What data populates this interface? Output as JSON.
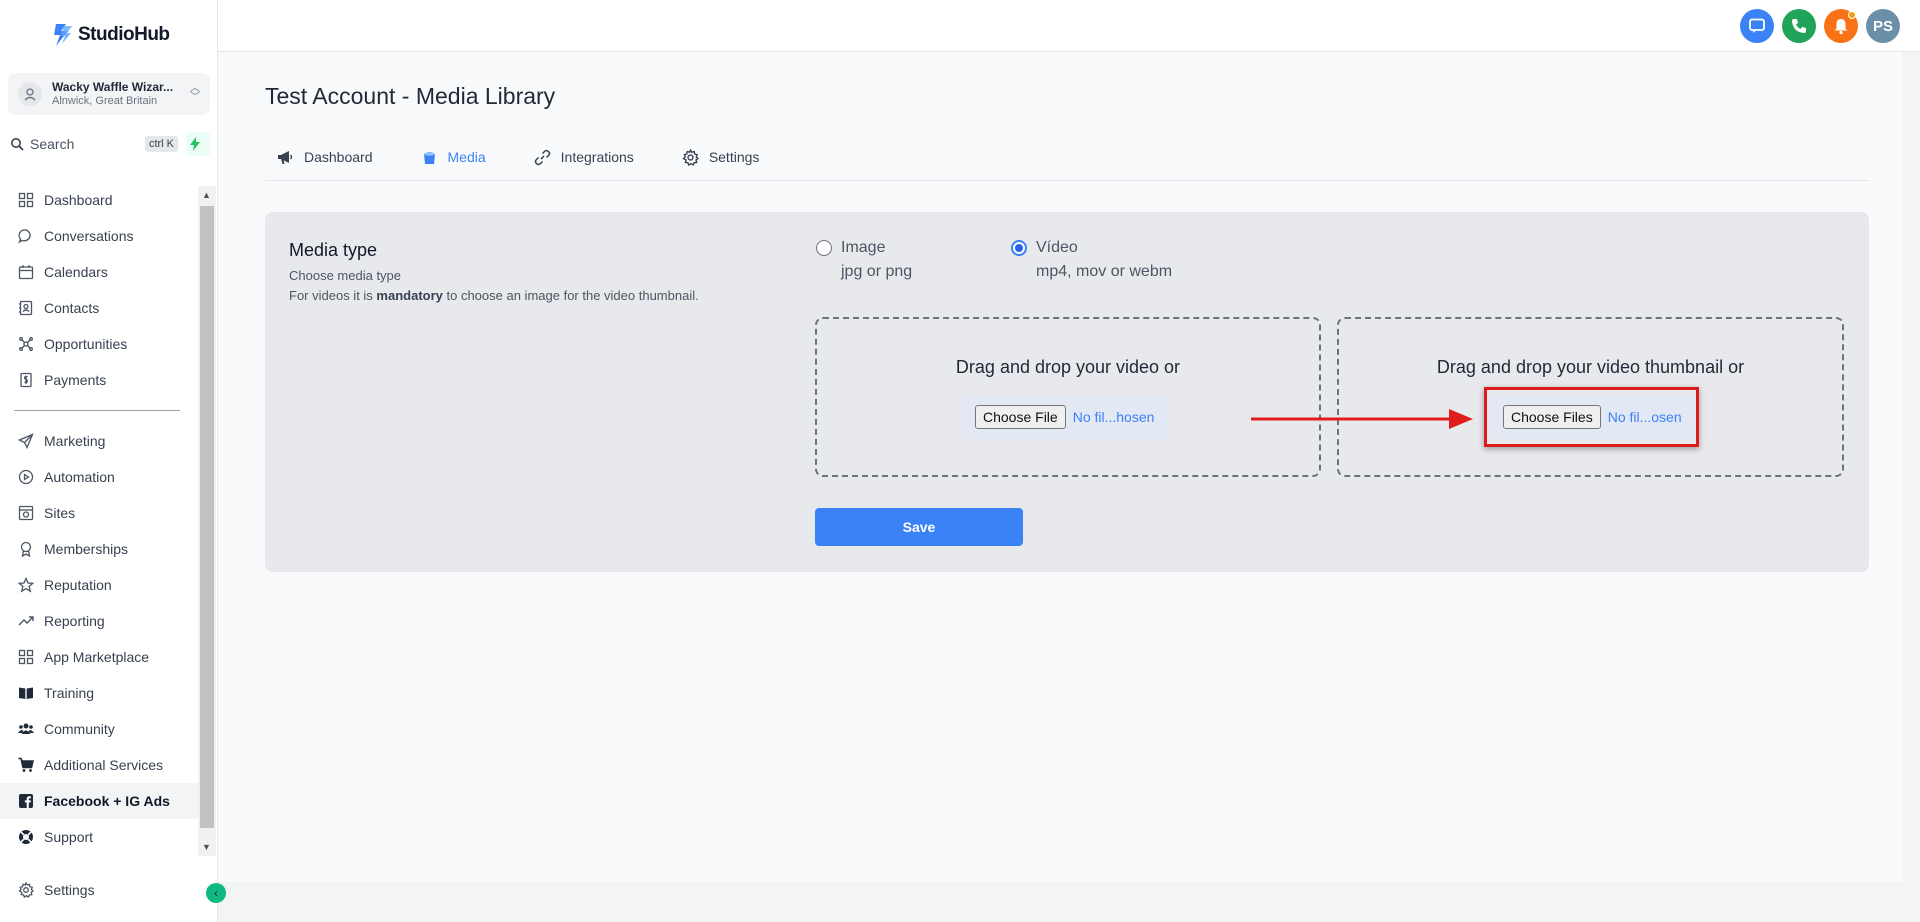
{
  "app": {
    "name": "StudioHub"
  },
  "account": {
    "name": "Wacky Waffle Wizar...",
    "location": "Alnwick, Great Britain"
  },
  "search": {
    "label": "Search",
    "shortcut": "ctrl K"
  },
  "sidebar": {
    "items": [
      {
        "label": "Dashboard",
        "icon": "grid-icon"
      },
      {
        "label": "Conversations",
        "icon": "chat-bubble-icon"
      },
      {
        "label": "Calendars",
        "icon": "calendar-icon"
      },
      {
        "label": "Contacts",
        "icon": "contacts-icon"
      },
      {
        "label": "Opportunities",
        "icon": "opportunities-icon"
      },
      {
        "label": "Payments",
        "icon": "payments-icon"
      }
    ],
    "items2": [
      {
        "label": "Marketing",
        "icon": "paper-plane-icon"
      },
      {
        "label": "Automation",
        "icon": "automation-icon"
      },
      {
        "label": "Sites",
        "icon": "sites-icon"
      },
      {
        "label": "Memberships",
        "icon": "membership-icon"
      },
      {
        "label": "Reputation",
        "icon": "star-icon"
      },
      {
        "label": "Reporting",
        "icon": "trend-icon"
      },
      {
        "label": "App Marketplace",
        "icon": "apps-icon"
      },
      {
        "label": "Training",
        "icon": "book-icon"
      },
      {
        "label": "Community",
        "icon": "users-icon"
      },
      {
        "label": "Additional Services",
        "icon": "cart-icon"
      },
      {
        "label": "Facebook + IG Ads",
        "icon": "facebook-icon"
      },
      {
        "label": "Support",
        "icon": "lifebuoy-icon"
      }
    ],
    "settings_label": "Settings"
  },
  "topbar": {
    "avatar_initials": "PS"
  },
  "page": {
    "title": "Test Account - Media Library"
  },
  "tabs": [
    {
      "label": "Dashboard",
      "active": false
    },
    {
      "label": "Media",
      "active": true
    },
    {
      "label": "Integrations",
      "active": false
    },
    {
      "label": "Settings",
      "active": false
    }
  ],
  "media_type": {
    "title": "Media type",
    "desc_line1": "Choose media type",
    "desc_pre": "For videos it is ",
    "desc_bold": "mandatory",
    "desc_post": " to choose an image for the video thumbnail.",
    "options": [
      {
        "label": "Image",
        "sub": "jpg or png",
        "checked": false
      },
      {
        "label": "Vídeo",
        "sub": "mp4, mov or webm",
        "checked": true
      }
    ]
  },
  "upload": {
    "video": {
      "prompt": "Drag and drop your video or",
      "button": "Choose File",
      "status": "No fil...hosen"
    },
    "thumbnail": {
      "prompt": "Drag and drop your video thumbnail or",
      "button": "Choose Files",
      "status": "No fil...osen"
    }
  },
  "save_label": "Save",
  "colors": {
    "accent": "#3b82f6",
    "highlight": "#dc1c1c",
    "chat": "#3b82f6",
    "phone": "#22a35a",
    "bell": "#f97316",
    "avatar": "#6b8fa8"
  }
}
